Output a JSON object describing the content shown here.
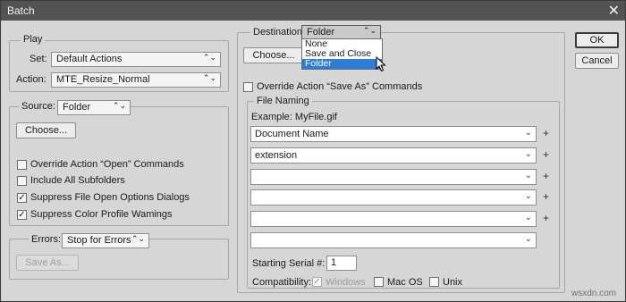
{
  "window": {
    "title": "Batch"
  },
  "play": {
    "legend": "Play",
    "set_label": "Set:",
    "set_value": "Default Actions",
    "action_label": "Action:",
    "action_value": "MTE_Resize_Normal"
  },
  "source": {
    "label": "Source:",
    "value": "Folder",
    "choose": "Choose...",
    "checkboxes": [
      {
        "label": "Override Action “Open” Commands",
        "checked": false
      },
      {
        "label": "Include All Subfolders",
        "checked": false
      },
      {
        "label": "Suppress File Open Options Dialogs",
        "checked": true
      },
      {
        "label": "Suppress Color Profile Wamings",
        "checked": true
      }
    ]
  },
  "errors": {
    "label": "Errors:",
    "value": "Stop for Errors",
    "save_as": "Save As..."
  },
  "destination": {
    "label": "Destination:",
    "value": "Folder",
    "choose": "Choose...",
    "options": [
      "None",
      "Save and Close",
      "Folder"
    ],
    "selected_option": "Folder",
    "override_label": "Override Action “Save As” Commands",
    "override_checked": false
  },
  "file_naming": {
    "legend": "File Naming",
    "example": "Example: MyFile.gif",
    "fields": [
      "Document Name",
      "extension",
      "",
      "",
      "",
      ""
    ],
    "plus": "+",
    "serial_label": "Starting Serial #:",
    "serial_value": "1",
    "compat_label": "Compatibility:",
    "compat": [
      {
        "label": "Windows",
        "checked": true,
        "disabled": true
      },
      {
        "label": "Mac OS",
        "checked": false,
        "disabled": false
      },
      {
        "label": "Unix",
        "checked": false,
        "disabled": false
      }
    ]
  },
  "buttons": {
    "ok": "OK",
    "cancel": "Cancel"
  },
  "watermark": "wsxdn.com",
  "icons": {
    "close": "close-icon",
    "dropdown": "chevron-down-icon",
    "checkmark": "check-icon",
    "cursor": "mouse-pointer-icon"
  }
}
